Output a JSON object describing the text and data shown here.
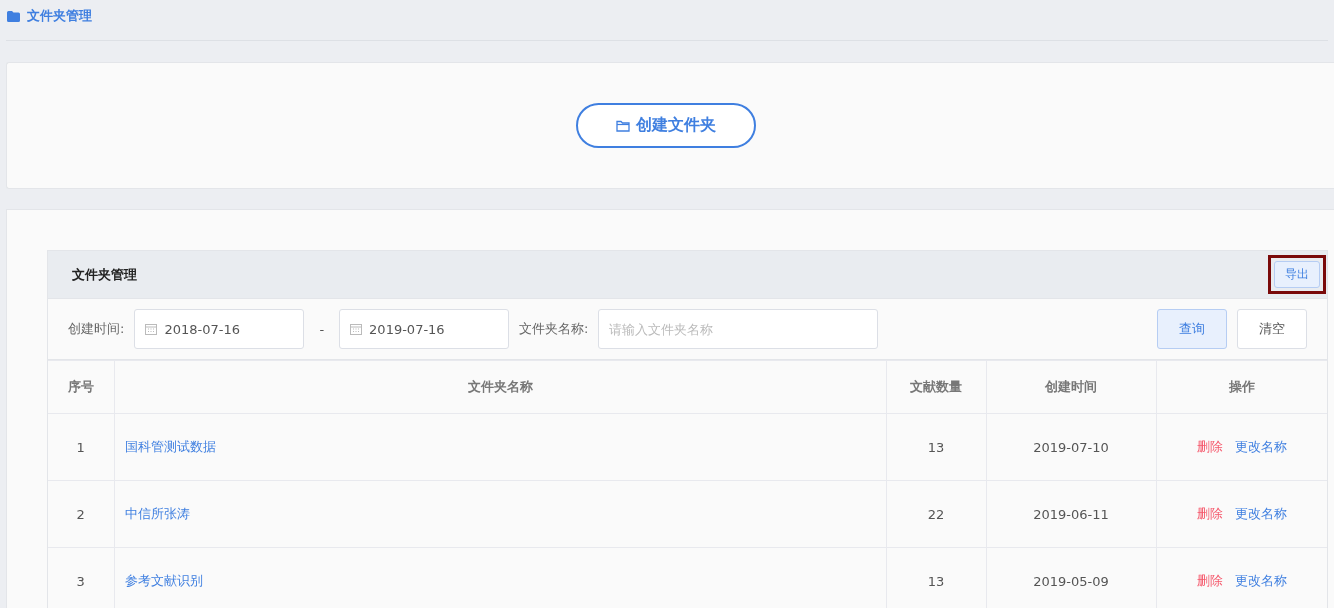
{
  "breadcrumb": {
    "title": "文件夹管理"
  },
  "create_button": {
    "label": "创建文件夹"
  },
  "panel": {
    "title": "文件夹管理",
    "export_button": "导出",
    "export_highlighted": true
  },
  "filters": {
    "date_label": "创建时间:",
    "start_date": "2018-07-16",
    "separator": "-",
    "end_date": "2019-07-16",
    "name_label": "文件夹名称:",
    "name_placeholder": "请输入文件夹名称",
    "search_button": "查询",
    "clear_button": "清空"
  },
  "table": {
    "columns": [
      "序号",
      "文件夹名称",
      "文献数量",
      "创建时间",
      "操作"
    ],
    "rows": [
      {
        "index": "1",
        "name": "国科管测试数据",
        "count": "13",
        "created": "2019-07-10",
        "actions": [
          "删除",
          "更改名称"
        ]
      },
      {
        "index": "2",
        "name": "中信所张涛",
        "count": "22",
        "created": "2019-06-11",
        "actions": [
          "删除",
          "更改名称"
        ]
      },
      {
        "index": "3",
        "name": "参考文献识别",
        "count": "13",
        "created": "2019-05-09",
        "actions": [
          "删除",
          "更改名称"
        ]
      }
    ]
  }
}
